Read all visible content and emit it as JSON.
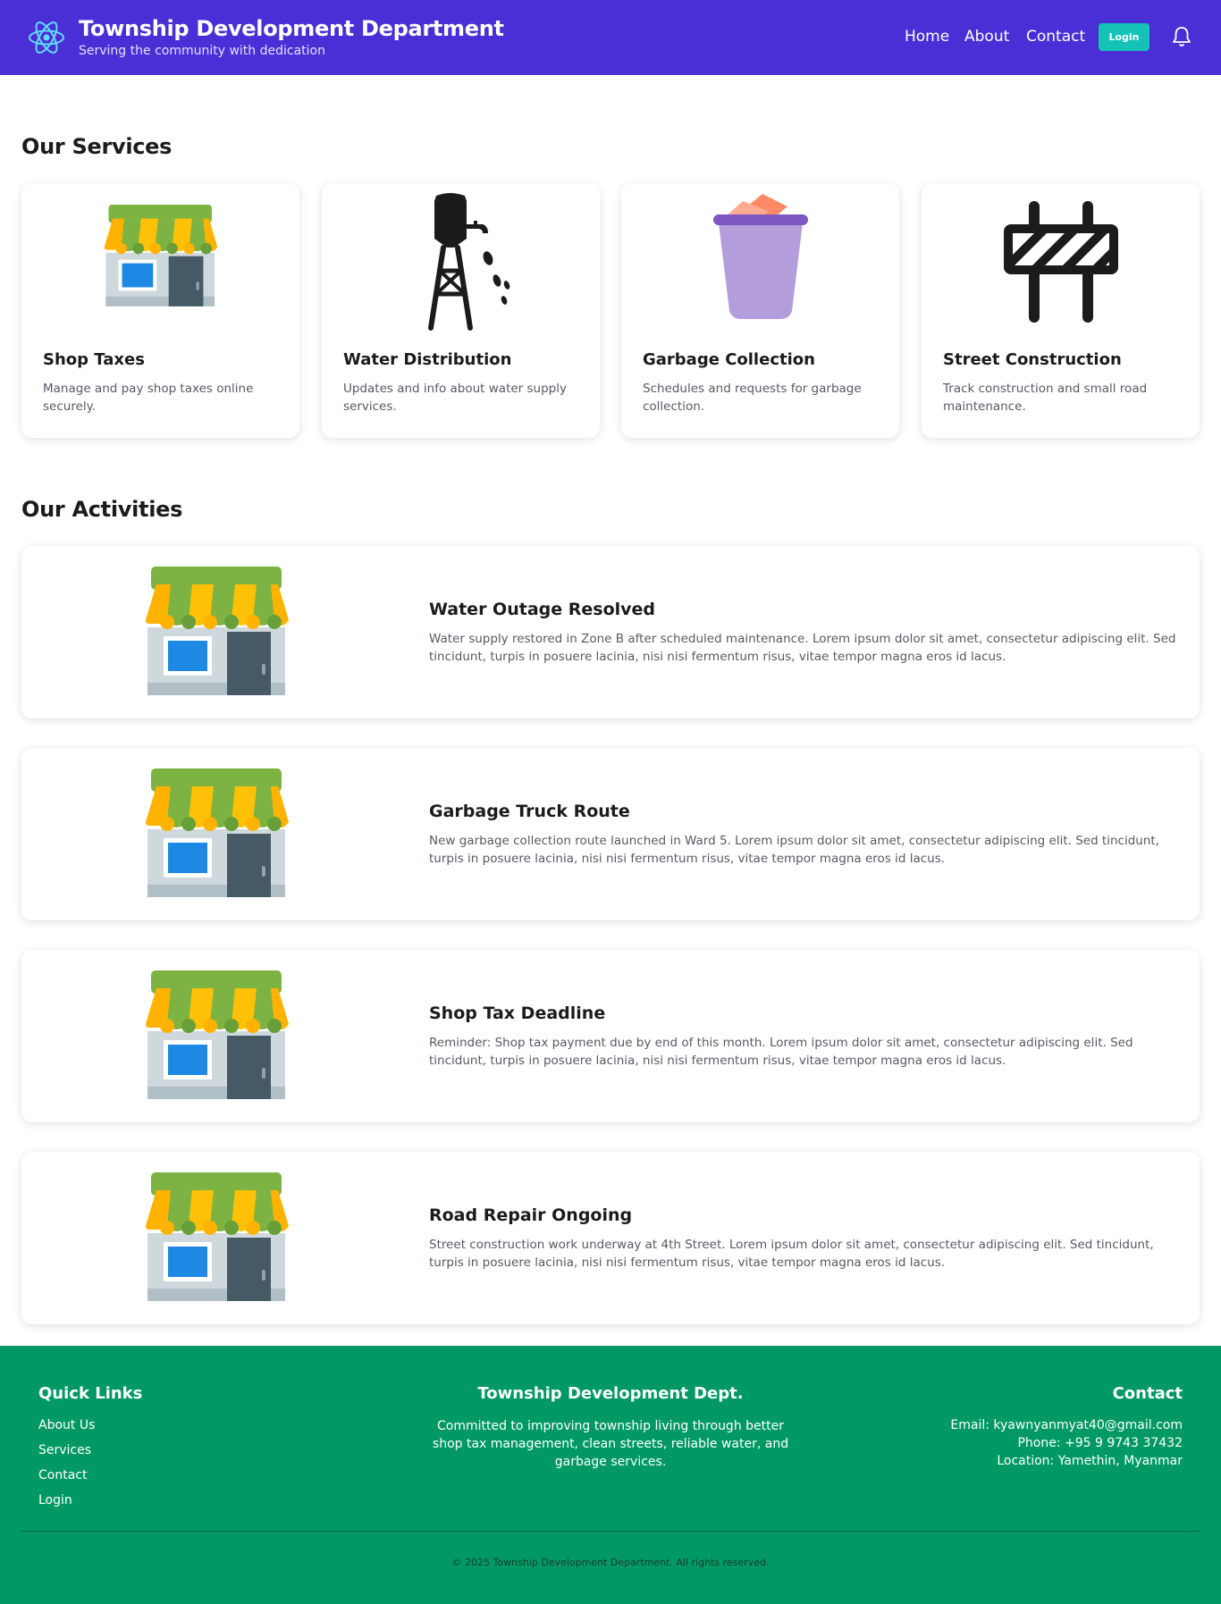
{
  "header": {
    "title": "Township Development Department",
    "subtitle": "Serving the community with dedication",
    "nav": [
      "Home",
      "About",
      "Contact"
    ],
    "login_label": "Login",
    "logo_icon": "atom-logo-icon",
    "bell_icon": "bell-icon",
    "accent": "#4a2fd6"
  },
  "services": {
    "title": "Our Services",
    "cards": [
      {
        "title": "Shop Taxes",
        "desc": "Manage and pay shop taxes online securely.",
        "icon": "shop-icon"
      },
      {
        "title": "Water Distribution",
        "desc": "Updates and info about water supply services.",
        "icon": "water-tower-icon"
      },
      {
        "title": "Garbage Collection",
        "desc": "Schedules and requests for garbage collection.",
        "icon": "trash-bin-icon"
      },
      {
        "title": "Street Construction",
        "desc": "Track construction and small road maintenance.",
        "icon": "road-barrier-icon"
      }
    ]
  },
  "activities": {
    "title": "Our Activities",
    "items": [
      {
        "title": "Water Outage Resolved",
        "desc": "Water supply restored in Zone B after scheduled maintenance. Lorem ipsum dolor sit amet, consectetur adipiscing elit. Sed tincidunt, turpis in posuere lacinia, nisi nisi fermentum risus, vitae tempor magna eros id lacus."
      },
      {
        "title": "Garbage Truck Route",
        "desc": "New garbage collection route launched in Ward 5. Lorem ipsum dolor sit amet, consectetur adipiscing elit. Sed tincidunt, turpis in posuere lacinia, nisi nisi fermentum risus, vitae tempor magna eros id lacus."
      },
      {
        "title": "Shop Tax Deadline",
        "desc": "Reminder: Shop tax payment due by end of this month. Lorem ipsum dolor sit amet, consectetur adipiscing elit. Sed tincidunt, turpis in posuere lacinia, nisi nisi fermentum risus, vitae tempor magna eros id lacus."
      },
      {
        "title": "Road Repair Ongoing",
        "desc": "Street construction work underway at 4th Street. Lorem ipsum dolor sit amet, consectetur adipiscing elit. Sed tincidunt, turpis in posuere lacinia, nisi nisi fermentum risus, vitae tempor magna eros id lacus."
      }
    ]
  },
  "footer": {
    "quick_links_title": "Quick Links",
    "links": [
      "About Us",
      "Services",
      "Contact",
      "Login"
    ],
    "org_title": "Township Development Dept.",
    "org_text": "Committed to improving township living through better shop tax management, clean streets, reliable water, and garbage services.",
    "contact_title": "Contact",
    "email": "Email: kyawnyanmyat40@gmail.com",
    "phone": "Phone: +95 9 9743 37432",
    "location": "Location: Yamethin, Myanmar",
    "copyright": "© 2025 Township Development Department. All rights reserved.",
    "color": "#009966"
  }
}
